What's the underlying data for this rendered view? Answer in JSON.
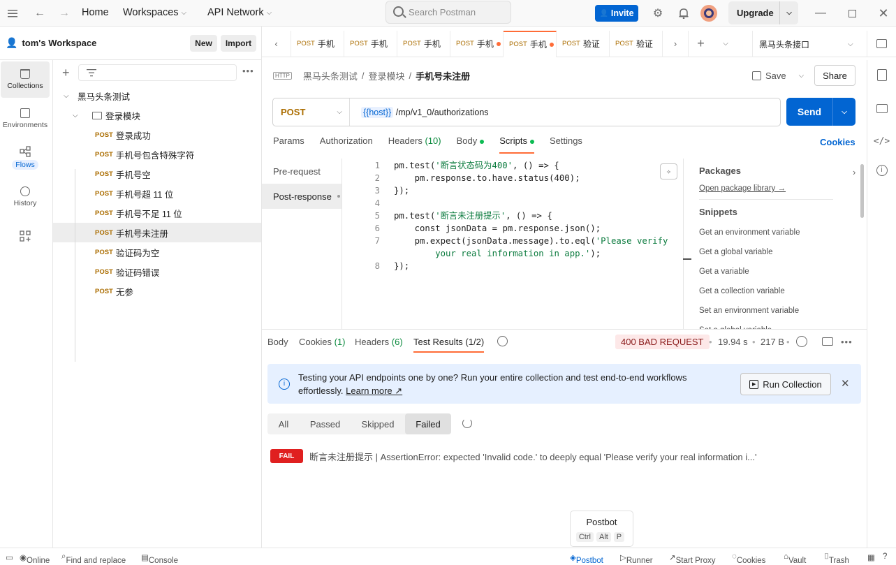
{
  "topbar": {
    "home": "Home",
    "workspaces": "Workspaces",
    "api_network": "API Network",
    "search_placeholder": "Search Postman",
    "invite": "Invite",
    "upgrade": "Upgrade"
  },
  "workspace": {
    "name": "tom's Workspace",
    "new_label": "New",
    "import_label": "Import"
  },
  "left_rail": [
    {
      "label": "Collections",
      "icon": "collections-icon"
    },
    {
      "label": "Environments",
      "icon": "environments-icon"
    },
    {
      "label": "Flows",
      "icon": "flows-icon"
    },
    {
      "label": "History",
      "icon": "history-icon"
    }
  ],
  "sidebar": {
    "collection": "黑马头条测试",
    "folder": "登录模块",
    "method_label": "POST",
    "requests": [
      "登录成功",
      "手机号包含特殊字符",
      "手机号空",
      "手机号超 11 位",
      "手机号不足 11 位",
      "手机号未注册",
      "验证码为空",
      "验证码错误",
      "无参"
    ],
    "selected_index": 5
  },
  "tabs": [
    {
      "method": "POST",
      "name": "手机",
      "dirty": false
    },
    {
      "method": "POST",
      "name": "手机",
      "dirty": false
    },
    {
      "method": "POST",
      "name": "手机",
      "dirty": false
    },
    {
      "method": "POST",
      "name": "手机",
      "dirty": true
    },
    {
      "method": "POST",
      "name": "手机",
      "dirty": true,
      "active": true
    },
    {
      "method": "POST",
      "name": "验证",
      "dirty": false
    },
    {
      "method": "POST",
      "name": "验证",
      "dirty": false
    }
  ],
  "environment": "黑马头条接口",
  "breadcrumb": {
    "collection": "黑马头条测试",
    "folder": "登录模块",
    "request": "手机号未注册",
    "sep": "/"
  },
  "actions": {
    "save": "Save",
    "share": "Share"
  },
  "request": {
    "method": "POST",
    "url_var": "{{host}}",
    "url_path": " /mp/v1_0/authorizations",
    "send": "Send"
  },
  "request_tabs": {
    "params": "Params",
    "authorization": "Authorization",
    "headers": "Headers",
    "headers_count": "(10)",
    "body": "Body",
    "scripts": "Scripts",
    "settings": "Settings",
    "cookies": "Cookies"
  },
  "script_nav": {
    "pre": "Pre-request",
    "post": "Post-response"
  },
  "code": {
    "line_numbers": [
      "1",
      "2",
      "3",
      "4",
      "5",
      "6",
      "7",
      "",
      "8"
    ],
    "l1a": "pm.test(",
    "l1s": "'断言状态码为400'",
    "l1b": ", () => {",
    "l2": "    pm.response.to.have.status(400);",
    "l3": "});",
    "l5a": "pm.test(",
    "l5s": "'断言未注册提示'",
    "l5b": ", () => {",
    "l6": "    const jsonData = pm.response.json();",
    "l7a": "    pm.expect(jsonData.message).to.eql(",
    "l7s": "'Please verify",
    "l7c": "        your real information in app.'",
    "l7d": ");",
    "l8": "});"
  },
  "snippets": {
    "packages": "Packages",
    "open_library": "Open package library →",
    "heading": "Snippets",
    "items": [
      "Get an environment variable",
      "Get a global variable",
      "Get a variable",
      "Get a collection variable",
      "Set an environment variable",
      "Set a global variable"
    ]
  },
  "response": {
    "body": "Body",
    "cookies": "Cookies",
    "cookies_count": "(1)",
    "headers": "Headers",
    "headers_count": "(6)",
    "test_results": "Test Results (1/2)",
    "status": "400 BAD REQUEST",
    "time": "19.94 s",
    "size": "217 B",
    "dot_sep": "•"
  },
  "banner": {
    "text": "Testing your API endpoints one by one? Run your entire collection and test end-to-end workflows effortlessly.",
    "learn_more": "Learn more ↗",
    "run_collection": "Run Collection"
  },
  "filters": {
    "all": "All",
    "passed": "Passed",
    "skipped": "Skipped",
    "failed": "Failed"
  },
  "result": {
    "badge": "FAIL",
    "text": "断言未注册提示 | AssertionError: expected 'Invalid code.' to deeply equal 'Please verify your real information i...'"
  },
  "postbot": {
    "title": "Postbot",
    "keys": [
      "Ctrl",
      "Alt",
      "P"
    ]
  },
  "statusbar": {
    "online": "Online",
    "find_replace": "Find and replace",
    "console": "Console",
    "postbot": "Postbot",
    "runner": "Runner",
    "start_proxy": "Start Proxy",
    "cookies": "Cookies",
    "vault": "Vault",
    "trash": "Trash"
  },
  "colors": {
    "accent": "#ff6c37",
    "primary": "#0265d2",
    "post_method": "#ab6d00",
    "fail": "#e02020"
  }
}
